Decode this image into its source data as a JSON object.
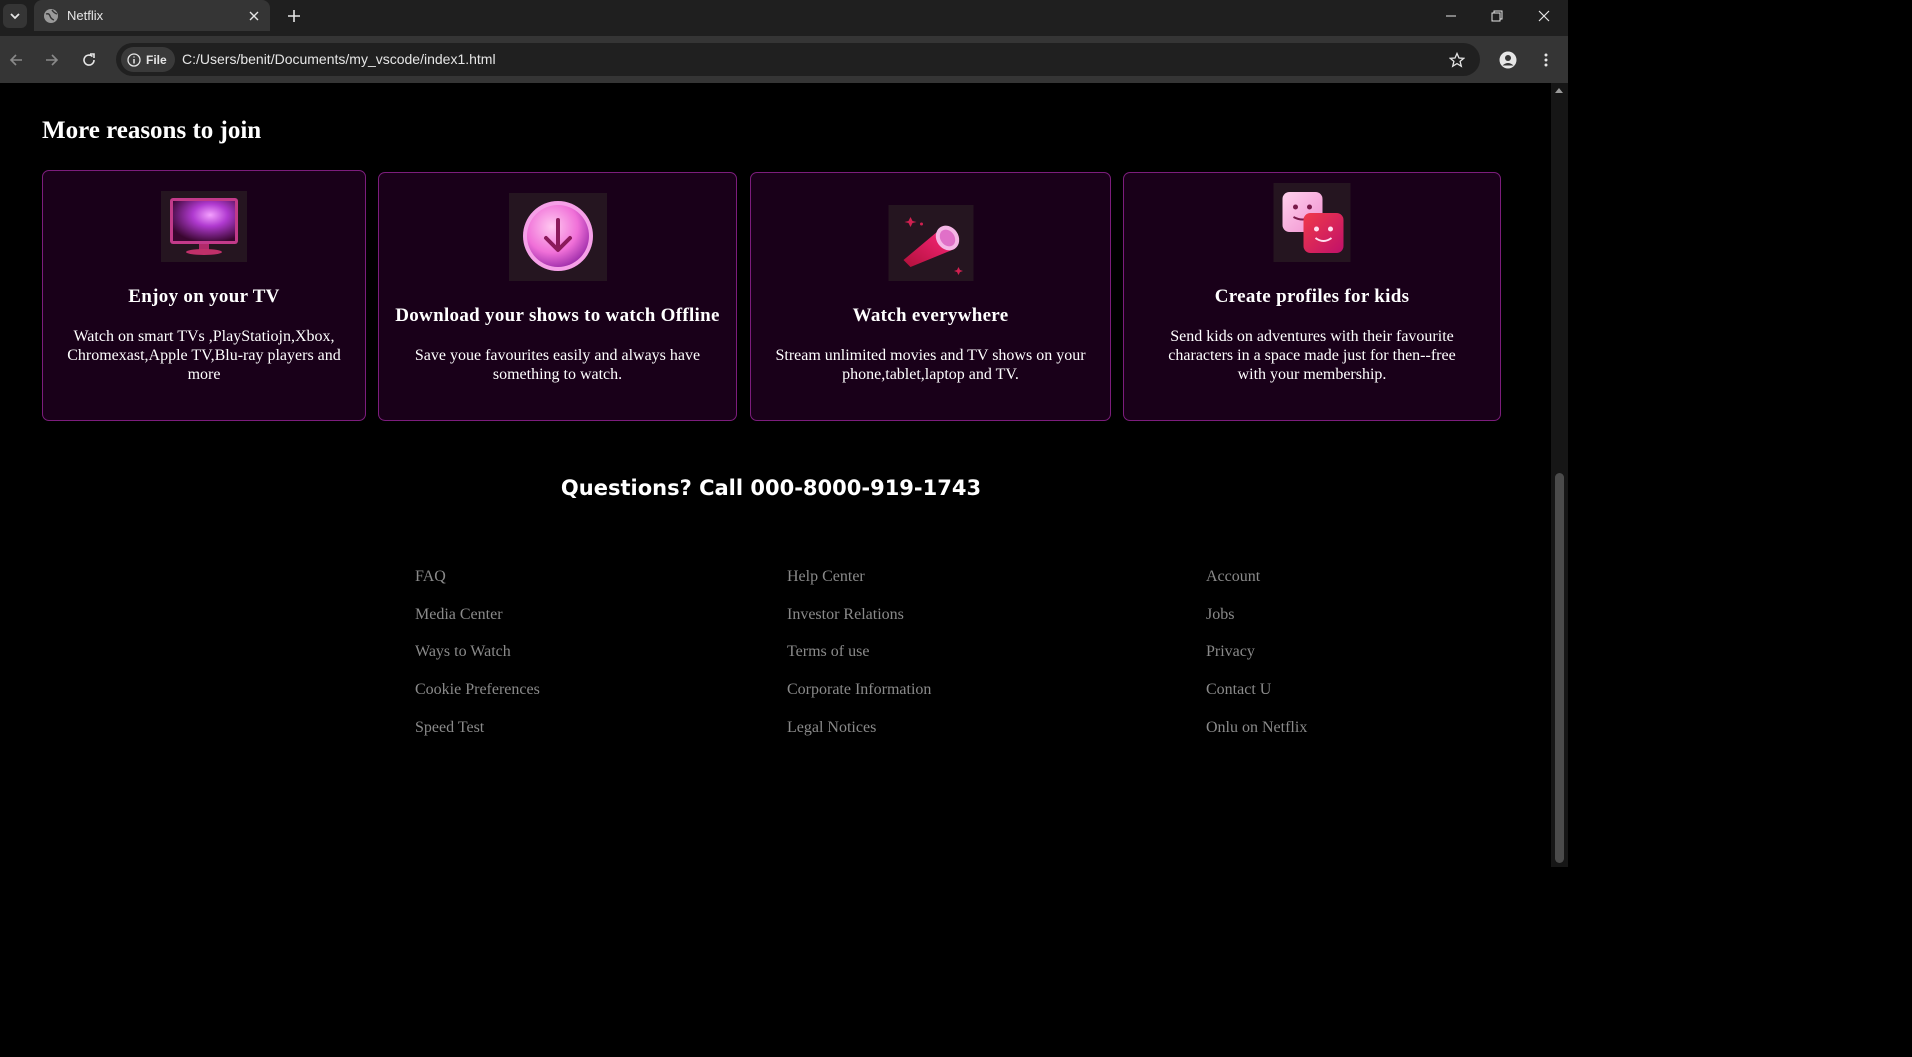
{
  "browser": {
    "tab_title": "Netflix",
    "address_chip": "File",
    "url": "C:/Users/benit/Documents/my_vscode/index1.html"
  },
  "page": {
    "heading": "More reasons to join",
    "cards": [
      {
        "title": "Enjoy on your TV",
        "description": "Watch on smart TVs ,PlayStatiojn,Xbox, Chromexast,Apple TV,Blu-ray players and more",
        "icon": "tv-icon"
      },
      {
        "title": "Download your shows to watch Offline",
        "description": "Save youe favourites easily and always have something to watch.",
        "icon": "download-icon"
      },
      {
        "title": "Watch everywhere",
        "description": "Stream unlimited movies and TV shows on your phone,tablet,laptop and TV.",
        "icon": "telescope-icon"
      },
      {
        "title": "Create profiles for kids",
        "description": "Send kids on adventures with their favourite characters in a space made just for then--free with your membership.",
        "icon": "profiles-icon"
      }
    ],
    "questions": "Questions? Call 000-8000-919-1743",
    "footer": {
      "col1": [
        "FAQ",
        "Media Center",
        "Ways to Watch",
        "Cookie Preferences",
        "Speed Test"
      ],
      "col2": [
        "Help Center",
        "Investor Relations",
        "Terms of use",
        "Corporate Information",
        "Legal Notices"
      ],
      "col3": [
        "Account",
        "Jobs",
        "Privacy",
        "Contact U",
        "Onlu on Netflix"
      ]
    }
  },
  "colors": {
    "card_border": "#7c1d7c",
    "card_bg": "#190019",
    "footer_link": "#8a8a8a"
  }
}
